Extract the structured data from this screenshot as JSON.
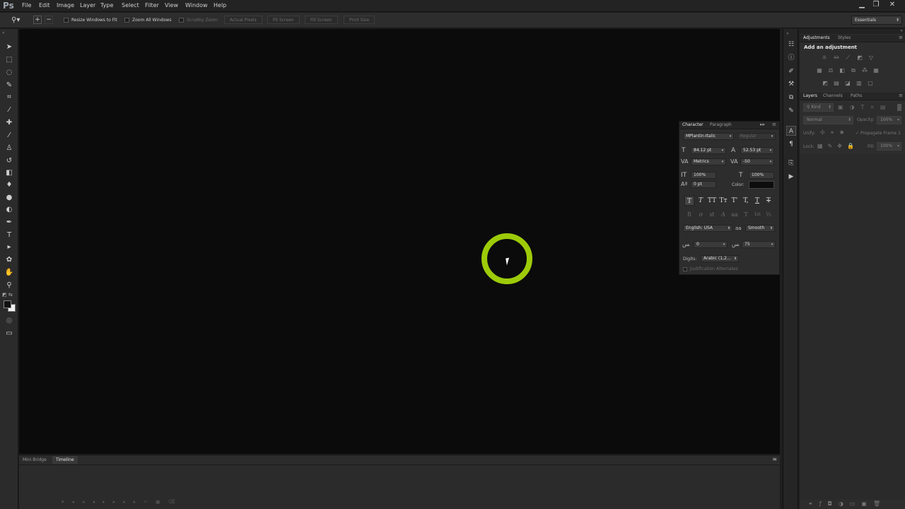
{
  "app": {
    "logo": "Ps"
  },
  "menu": [
    "File",
    "Edit",
    "Image",
    "Layer",
    "Type",
    "Select",
    "Filter",
    "View",
    "Window",
    "Help"
  ],
  "window_controls": {
    "minimize": "▁",
    "restore": "❐",
    "close": "✕"
  },
  "options": {
    "resize_windows": "Resize Windows to Fit",
    "zoom_all": "Zoom All Windows",
    "scrubby_zoom": "Scrubby Zoom",
    "actual_pixels": "Actual Pixels",
    "fit_screen": "Fit Screen",
    "fill_screen": "Fill Screen",
    "print_size": "Print Size",
    "workspace": "Essentials"
  },
  "bottom": {
    "tabs": [
      "Mini Bridge",
      "Timeline"
    ],
    "active_tab": "Timeline"
  },
  "right": {
    "tabs_top": [
      "Adjustments",
      "Styles"
    ],
    "add_adjustment": "Add an adjustment",
    "tabs_layers": [
      "Layers",
      "Channels",
      "Paths"
    ],
    "kind": "Kind",
    "blend_mode": "Normal",
    "opacity_label": "Opacity:",
    "opacity": "100%",
    "unify_label": "Unify:",
    "propagate": "Propagate Frame 1",
    "lock_label": "Lock:",
    "fill_label": "Fill:",
    "fill": "100%"
  },
  "character": {
    "tabs": [
      "Character",
      "Paragraph"
    ],
    "font_family": "MPlantin-Italic",
    "font_style": "Regular",
    "size": "84.12 pt",
    "leading": "52.53 pt",
    "kerning": "Metrics",
    "tracking": "-50",
    "vscale": "100%",
    "hscale": "100%",
    "baseline": "0 pt",
    "color_label": "Color:",
    "language": "English: USA",
    "aa_label": "aa",
    "antialias": "Smooth",
    "kashida_left": "0",
    "kashida_right": "75",
    "digits_label": "Digits:",
    "digits": "Arabic (1,2...",
    "justification": "Justification Alternates",
    "style_buttons": [
      "T",
      "T",
      "TT",
      "Tт",
      "T'",
      "T,",
      "T",
      "T"
    ],
    "ot_buttons": [
      "ﬁ",
      "ơ",
      "st",
      "A",
      "aa",
      "T",
      "1st",
      "½"
    ]
  }
}
